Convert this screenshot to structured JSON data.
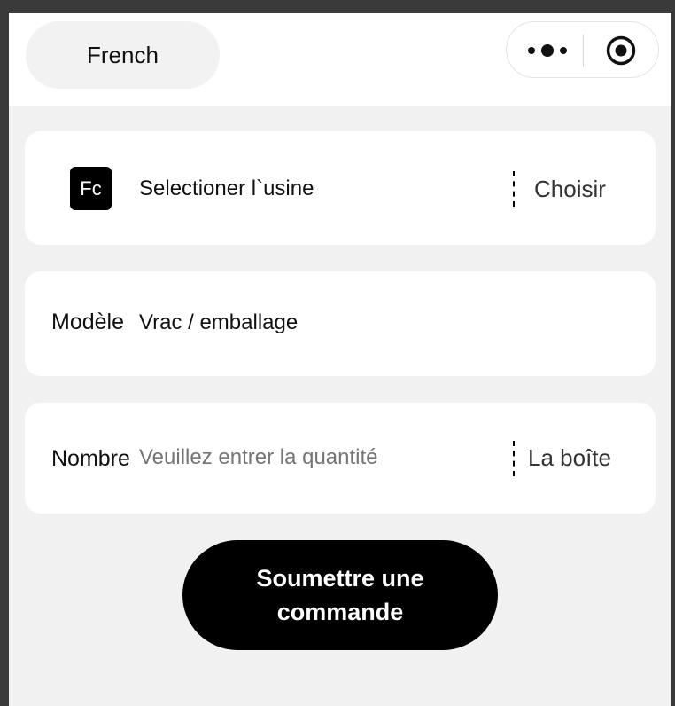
{
  "header": {
    "language_label": "French",
    "more_icon": "more-dots-icon",
    "target_icon": "record-target-icon"
  },
  "factory": {
    "icon_text": "Fc",
    "label": "Selectioner l`usine",
    "choose_label": "Choisir"
  },
  "model": {
    "label": "Modèle",
    "value": "Vrac / emballage"
  },
  "quantity": {
    "label": "Nombre",
    "placeholder": "Veuillez entrer la quantité",
    "unit": "La boîte"
  },
  "submit_label": "Soumettre une commande",
  "colors": {
    "accent": "#000000",
    "background": "#f1f1f1",
    "card": "#ffffff"
  }
}
